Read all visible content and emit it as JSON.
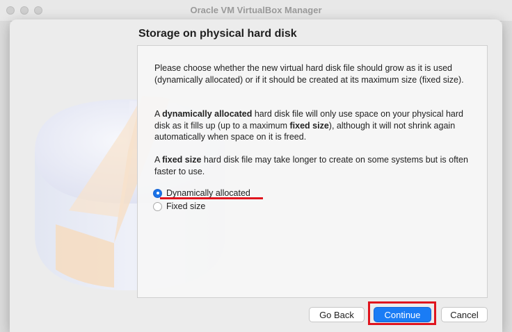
{
  "window": {
    "title": "Oracle VM VirtualBox Manager"
  },
  "dialog": {
    "heading": "Storage on physical hard disk",
    "paragraph1": "Please choose whether the new virtual hard disk file should grow as it is used (dynamically allocated) or if it should be created at its maximum size (fixed size).",
    "paragraph2_parts": [
      "A ",
      "dynamically allocated",
      " hard disk file will only use space on your physical hard disk as it fills up (up to a maximum ",
      "fixed size",
      "), although it will not shrink again automatically when space on it is freed."
    ],
    "paragraph3_parts": [
      "A ",
      "fixed size",
      " hard disk file may take longer to create on some systems but is often faster to use."
    ],
    "options": [
      {
        "label": "Dynamically allocated",
        "selected": true
      },
      {
        "label": "Fixed size",
        "selected": false
      }
    ],
    "buttons": {
      "back": "Go Back",
      "continue": "Continue",
      "cancel": "Cancel"
    }
  },
  "colors": {
    "accent": "#1a7cf5",
    "highlight": "#e0141e"
  },
  "icons": {
    "watermark": "hard-disk-pie-icon"
  }
}
